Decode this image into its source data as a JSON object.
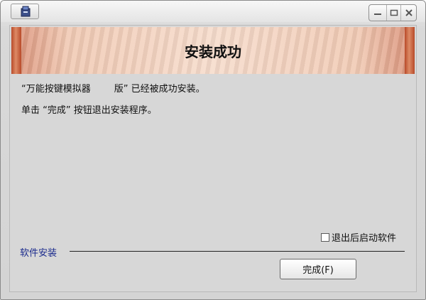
{
  "window": {
    "icon": "installer-icon",
    "controls": [
      "minimize-icon",
      "restore-icon",
      "close-icon"
    ]
  },
  "banner": {
    "title": "安装成功"
  },
  "messages": {
    "line1": "“万能按键模拟器        版” 已经被成功安装。",
    "line2": "单击 “完成” 按钮退出安装程序。"
  },
  "options": {
    "launch_label": "退出后启动软件",
    "launch_checked": false
  },
  "footer": {
    "group_label": "软件安装",
    "finish_label": "完成(F)"
  }
}
